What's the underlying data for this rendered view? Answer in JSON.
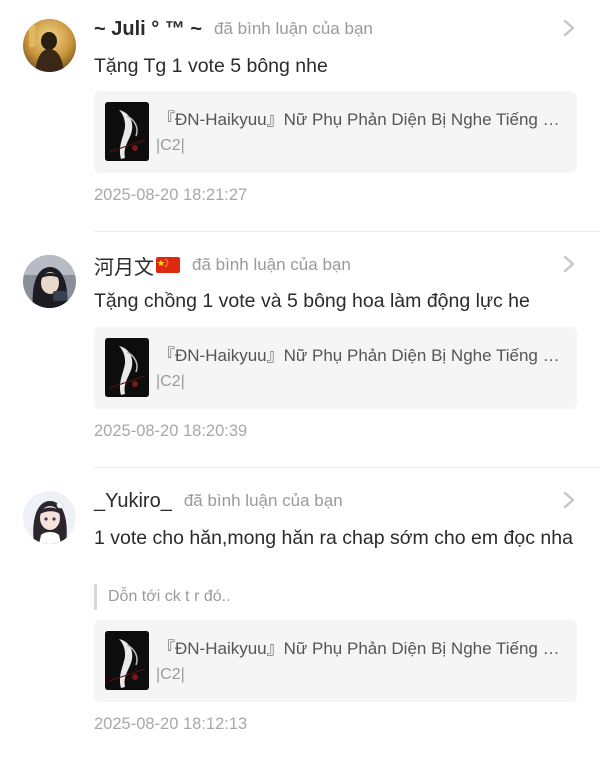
{
  "notifications": [
    {
      "username": "~ Juli ° ™ ~",
      "action": "đã bình luận của bạn",
      "comment": "Tặng Tg 1 vote 5 bông nhe",
      "story_title": "『ĐN-Haikyuu』Nữ Phụ Phản Diện Bị Nghe Tiếng Lòng",
      "chapter": "|C2|",
      "timestamp": "2025-08-20 18:21:27",
      "avatar_icon": "avatar-girl-golden-icon"
    },
    {
      "username": "河月文",
      "flag_icon": "china-flag-icon",
      "action": "đã bình luận của bạn",
      "comment": "Tặng chồng 1 vote và 5 bông hoa làm động lực he",
      "story_title": "『ĐN-Haikyuu』Nữ Phụ Phản Diện Bị Nghe Tiếng Lòng",
      "chapter": "|C2|",
      "timestamp": "2025-08-20 18:20:39",
      "avatar_icon": "avatar-girl-dark-icon"
    },
    {
      "username": "_Yukiro_",
      "action": "đã bình luận của bạn",
      "comment": "1 vote cho hăn,mong hăn ra chap sớm cho em đọc nha",
      "quote": "Dỗn tới ck t r đó..",
      "story_title": "『ĐN-Haikyuu』Nữ Phụ Phản Diện Bị Nghe Tiếng Lòng",
      "chapter": "|C2|",
      "timestamp": "2025-08-20 18:12:13",
      "avatar_icon": "avatar-anime-girl-icon"
    }
  ],
  "colors": {
    "text": "#2b2b2b",
    "muted": "#9a9a9a",
    "card_bg": "#f5f5f5",
    "divider": "#ececec"
  }
}
